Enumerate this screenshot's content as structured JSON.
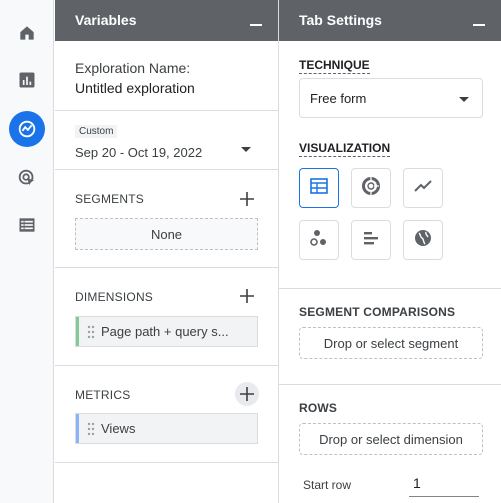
{
  "rail": {
    "items": [
      {
        "icon": "home-icon"
      },
      {
        "icon": "reports-bar-chart-icon"
      },
      {
        "icon": "explore-icon",
        "active": true
      },
      {
        "icon": "advertising-cursor-icon"
      },
      {
        "icon": "table-list-icon"
      }
    ]
  },
  "variables": {
    "title": "Variables",
    "exploration_label": "Exploration Name:",
    "exploration_name": "Untitled exploration",
    "date_badge": "Custom",
    "date_range": "Sep 20 - Oct 19, 2022",
    "segments_label": "SEGMENTS",
    "segments_item": "None",
    "dimensions_label": "DIMENSIONS",
    "dimensions_item": "Page path + query s...",
    "metrics_label": "METRICS",
    "metrics_item": "Views"
  },
  "tab_settings": {
    "title": "Tab Settings",
    "technique_label": "TECHNIQUE",
    "technique_value": "Free form",
    "visualization_label": "VISUALIZATION",
    "visualizations": [
      {
        "icon": "table-icon",
        "selected": true
      },
      {
        "icon": "donut-chart-icon"
      },
      {
        "icon": "line-chart-icon"
      },
      {
        "icon": "scatter-plot-icon"
      },
      {
        "icon": "bar-chart-icon"
      },
      {
        "icon": "geo-map-icon"
      }
    ],
    "segment_comparisons_label": "SEGMENT COMPARISONS",
    "segment_drop": "Drop or select segment",
    "rows_label": "ROWS",
    "rows_drop": "Drop or select dimension",
    "start_row_label": "Start row",
    "start_row_value": "1"
  },
  "colors": {
    "accent": "#1a73e8",
    "header": "#5f6368",
    "dimension_bar": "#81c995",
    "metric_bar": "#8ab4f8"
  }
}
